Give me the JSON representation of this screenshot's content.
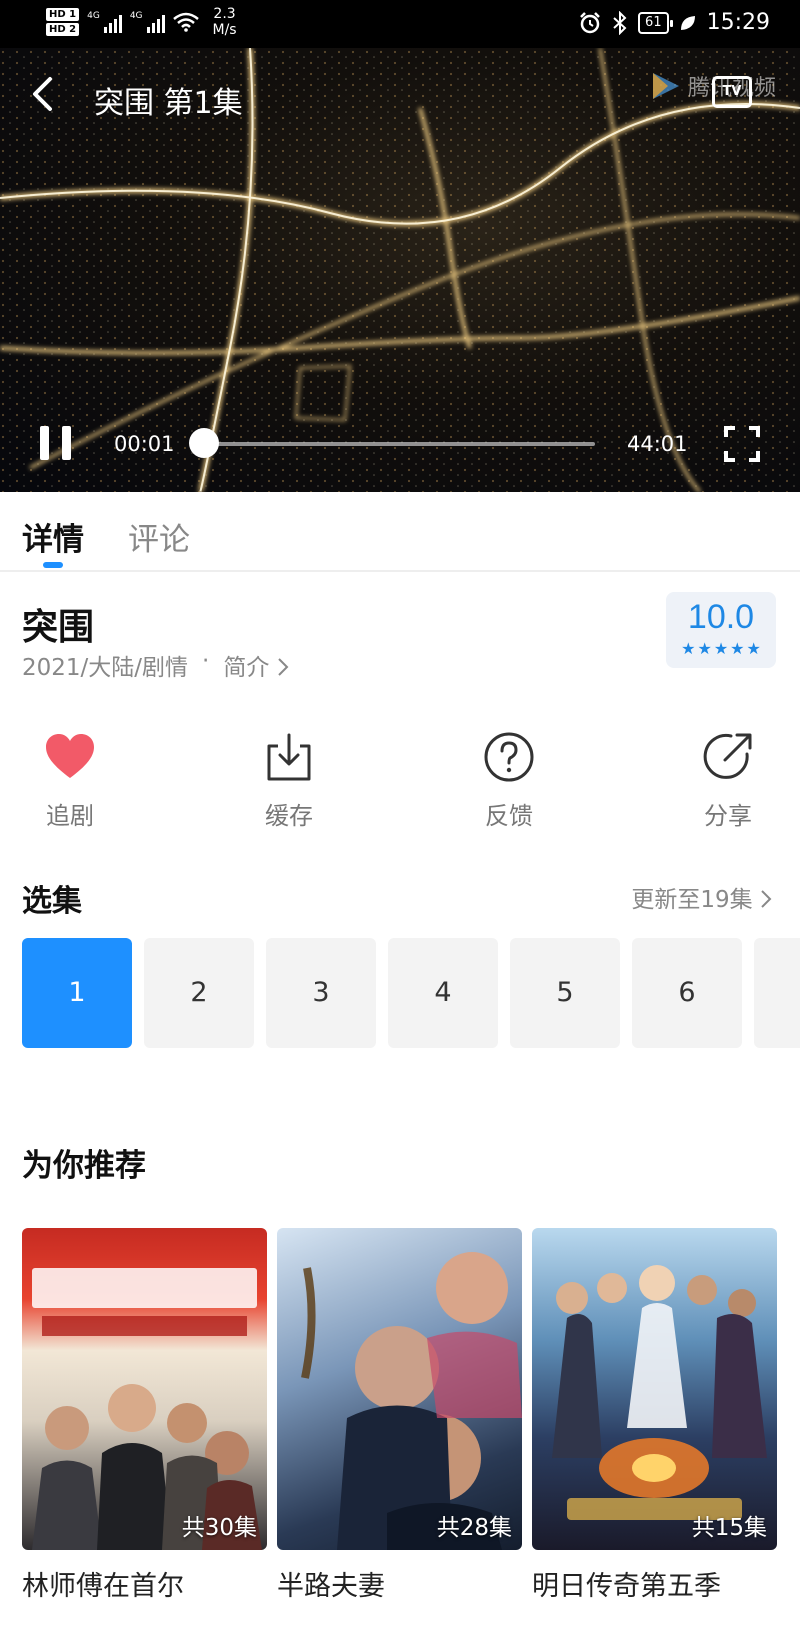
{
  "status_bar": {
    "hd1": "HD 1",
    "hd2": "HD 2",
    "net1": "4G",
    "net2": "4G",
    "speed_value": "2.3",
    "speed_unit": "M/s",
    "battery": "61",
    "time": "15:29"
  },
  "player": {
    "title": "突围 第1集",
    "brand": "腾讯视频",
    "tv_badge": "TV",
    "current_time": "00:01",
    "duration": "44:01",
    "progress": 0.0004
  },
  "tabs": [
    {
      "label": "详情",
      "active": true
    },
    {
      "label": "评论",
      "active": false
    }
  ],
  "show": {
    "title": "突围",
    "meta": "2021/大陆/剧情",
    "separator": "·",
    "intro_link": "简介",
    "rating": "10.0",
    "stars": 5
  },
  "actions": [
    {
      "label": "追剧",
      "icon": "heart-icon"
    },
    {
      "label": "缓存",
      "icon": "download-icon"
    },
    {
      "label": "反馈",
      "icon": "question-icon"
    },
    {
      "label": "分享",
      "icon": "share-icon"
    }
  ],
  "episodes": {
    "title": "选集",
    "update_text": "更新至19集",
    "items": [
      "1",
      "2",
      "3",
      "4",
      "5",
      "6"
    ],
    "selected": "1"
  },
  "recommendations": {
    "title": "为你推荐",
    "items": [
      {
        "name": "林师傅在首尔",
        "count": "共30集"
      },
      {
        "name": "半路夫妻",
        "count": "共28集"
      },
      {
        "name": "明日传奇第五季",
        "count": "共15集"
      }
    ]
  },
  "colors": {
    "accent": "#1e90ff",
    "heart": "#f25a68",
    "rating": "#1e88e5"
  }
}
